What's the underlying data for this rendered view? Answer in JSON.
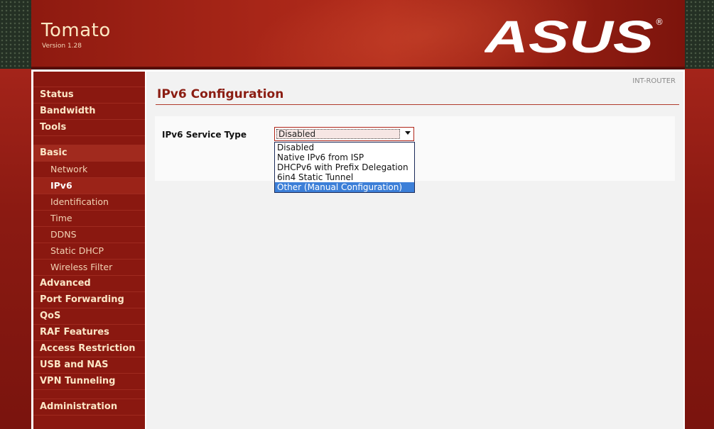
{
  "header": {
    "app_title": "Tomato",
    "app_version": "Version 1.28",
    "brand_logo": "ASUS",
    "brand_mark": "®"
  },
  "router_name": "INT-ROUTER",
  "sidebar": {
    "top_items": [
      {
        "label": "Status"
      },
      {
        "label": "Bandwidth"
      },
      {
        "label": "Tools"
      }
    ],
    "basic": {
      "label": "Basic",
      "items": [
        {
          "label": "Network"
        },
        {
          "label": "IPv6"
        },
        {
          "label": "Identification"
        },
        {
          "label": "Time"
        },
        {
          "label": "DDNS"
        },
        {
          "label": "Static DHCP"
        },
        {
          "label": "Wireless Filter"
        }
      ]
    },
    "more_items": [
      {
        "label": "Advanced"
      },
      {
        "label": "Port Forwarding"
      },
      {
        "label": "QoS"
      },
      {
        "label": "RAF Features"
      },
      {
        "label": "Access Restriction"
      },
      {
        "label": "USB and NAS"
      },
      {
        "label": "VPN Tunneling"
      }
    ],
    "admin": {
      "label": "Administration"
    }
  },
  "page": {
    "title": "IPv6 Configuration",
    "field_label": "IPv6 Service Type",
    "select_value": "Disabled",
    "options": [
      {
        "label": "Disabled"
      },
      {
        "label": "Native IPv6 from ISP"
      },
      {
        "label": "DHCPv6 with Prefix Delegation"
      },
      {
        "label": "6in4 Static Tunnel"
      },
      {
        "label": "Other (Manual Configuration)"
      }
    ]
  }
}
